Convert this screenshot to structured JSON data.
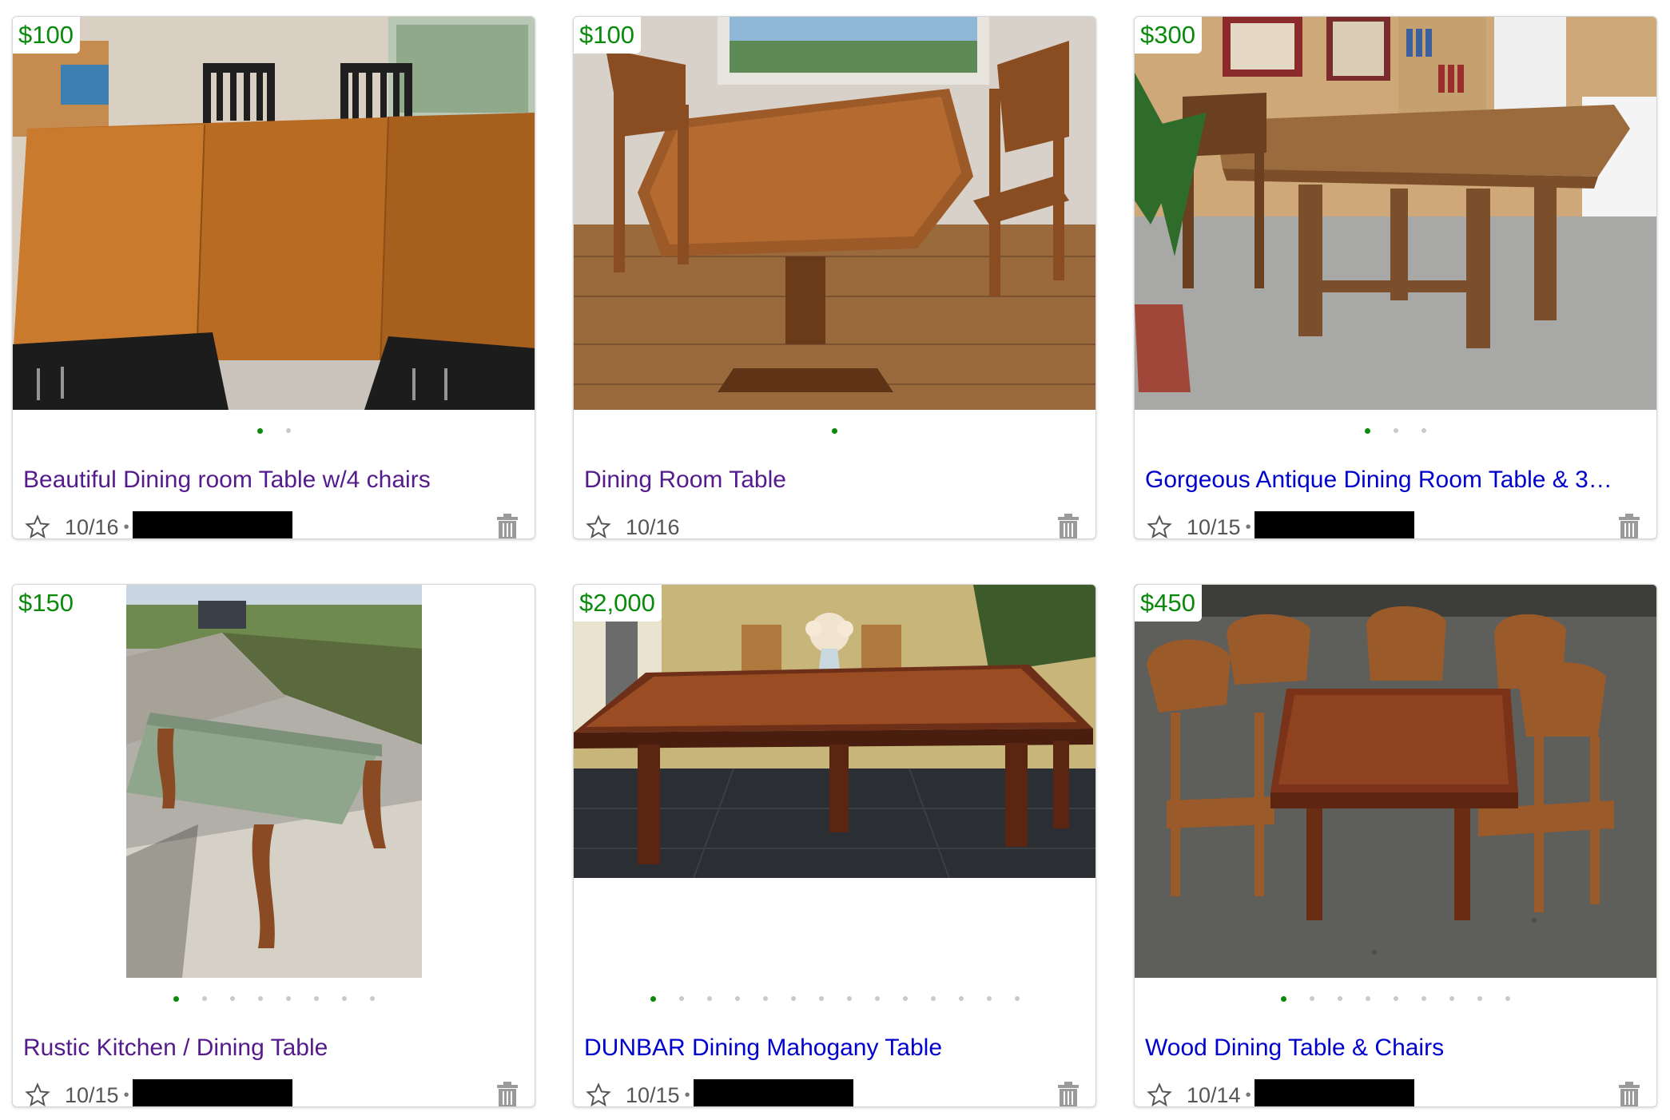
{
  "listings": [
    {
      "price": "$100",
      "title": "Beautiful Dining room Table w/4 chairs",
      "date": "10/16",
      "dots": 2,
      "active_dot": 0,
      "visited": true,
      "redacted": true
    },
    {
      "price": "$100",
      "title": "Dining Room Table",
      "date": "10/16",
      "dots": 1,
      "active_dot": 0,
      "visited": true,
      "redacted": false
    },
    {
      "price": "$300",
      "title": "Gorgeous Antique Dining Room Table & 3…",
      "date": "10/15",
      "dots": 3,
      "active_dot": 0,
      "visited": false,
      "redacted": true
    },
    {
      "price": "$150",
      "title": "Rustic Kitchen / Dining Table",
      "date": "10/15",
      "dots": 8,
      "active_dot": 0,
      "visited": true,
      "redacted": true
    },
    {
      "price": "$2,000",
      "title": "DUNBAR Dining Mahogany Table",
      "date": "10/15",
      "dots": 14,
      "active_dot": 0,
      "visited": false,
      "redacted": true
    },
    {
      "price": "$450",
      "title": "Wood Dining Table & Chairs",
      "date": "10/14",
      "dots": 9,
      "active_dot": 0,
      "visited": false,
      "redacted": true
    }
  ],
  "meta_separator": "•",
  "icons": {
    "favorite": "star-outline-icon",
    "hide": "trash-icon"
  },
  "colors": {
    "price": "#0a8a0a",
    "visited_link": "#551a8b",
    "link": "#0000cc",
    "active_dot": "#0a8a0a",
    "inactive_dot": "#c9c9c9"
  }
}
